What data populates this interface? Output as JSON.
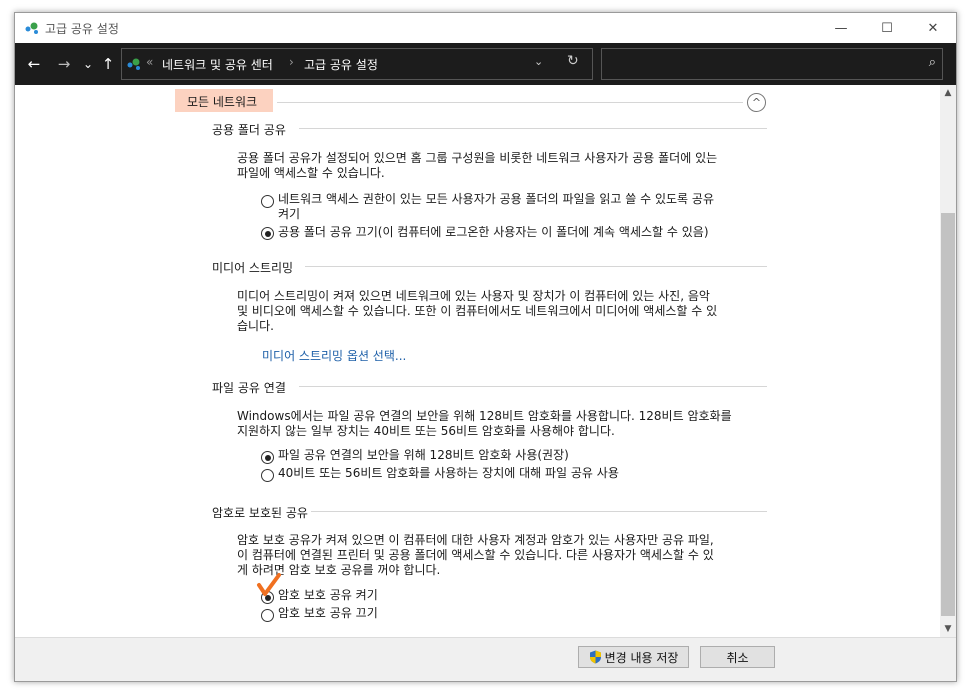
{
  "window": {
    "title": "고급 공유 설정",
    "minimize": "—",
    "maximize": "☐",
    "close": "✕"
  },
  "nav": {
    "back": "←",
    "forward": "→",
    "recent": "⌄",
    "up": "↑",
    "separator": "«",
    "crumb_arrow": "›",
    "breadcrumb": [
      "네트워크 및 공유 센터",
      "고급 공유 설정"
    ],
    "dropdown": "⌄",
    "refresh": "↻",
    "search_placeholder": "",
    "search_icon": "⌕"
  },
  "profile": {
    "label": "모든 네트워크",
    "collapse_icon": "^"
  },
  "sections": {
    "public_folder": {
      "header": "공용 폴더 공유",
      "description_line1": "공용 폴더 공유가 설정되어 있으면 홈 그룹 구성원을 비롯한 네트워크 사용자가 공용 폴더에 있는",
      "description_line2": "파일에 액세스할 수 있습니다.",
      "option_on_line1": "네트워크 액세스 권한이 있는 모든 사용자가 공용 폴더의 파일을 읽고 쓸 수 있도록 공유",
      "option_on_line2": "켜기",
      "option_off": "공용 폴더 공유 끄기(이 컴퓨터에 로그온한 사용자는 이 폴더에 계속 액세스할 수 있음)",
      "selected": "off"
    },
    "media": {
      "header": "미디어 스트리밍",
      "description_line1": "미디어 스트리밍이 켜져 있으면 네트워크에 있는 사용자 및 장치가 이 컴퓨터에 있는 사진, 음악",
      "description_line2": "및 비디오에 액세스할 수 있습니다. 또한 이 컴퓨터에서도 네트워크에서 미디어에 액세스할 수 있",
      "description_line3": "습니다.",
      "link": "미디어 스트리밍 옵션 선택..."
    },
    "file_sharing": {
      "header": "파일 공유 연결",
      "description_line1": "Windows에서는 파일 공유 연결의 보안을 위해 128비트 암호화를 사용합니다. 128비트 암호화를",
      "description_line2": "지원하지 않는 일부 장치는 40비트 또는 56비트 암호화를 사용해야 합니다.",
      "option_128": "파일 공유 연결의 보안을 위해 128비트 암호화 사용(권장)",
      "option_40_56": "40비트 또는 56비트 암호화를 사용하는 장치에 대해 파일 공유 사용",
      "selected": "128"
    },
    "password": {
      "header": "암호로 보호된 공유",
      "description_line1": "암호 보호 공유가 켜져 있으면 이 컴퓨터에 대한 사용자 계정과 암호가 있는 사용자만 공유 파일,",
      "description_line2": "이 컴퓨터에 연결된 프린터 및 공용 폴더에 액세스할 수 있습니다. 다른 사용자가 액세스할 수 있",
      "description_line3": "게 하려면 암호 보호 공유를 꺼야 합니다.",
      "option_on": "암호 보호 공유 켜기",
      "option_off": "암호 보호 공유 끄기",
      "selected": "on"
    }
  },
  "buttons": {
    "save": "변경 내용 저장",
    "cancel": "취소"
  },
  "colors": {
    "highlight": "#fcd2c0",
    "checkmark": "#f07020",
    "link": "#1d5fa8"
  },
  "scrollbar": {
    "up": "▲",
    "down": "▼"
  }
}
